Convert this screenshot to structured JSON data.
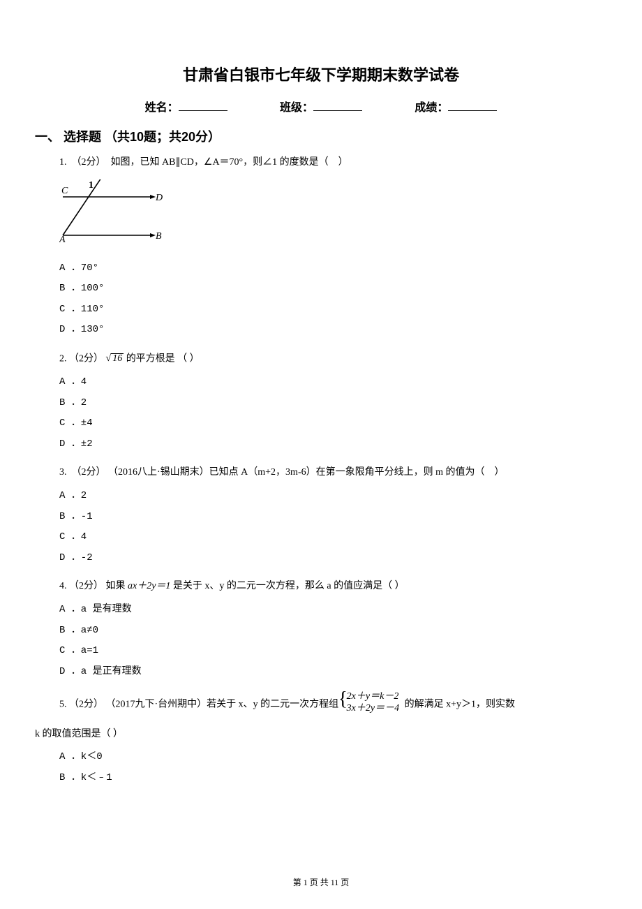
{
  "title": "甘肃省白银市七年级下学期期末数学试卷",
  "info": {
    "name_label": "姓名：",
    "class_label": "班级：",
    "score_label": "成绩："
  },
  "section1": {
    "header": "一、 选择题 （共10题；共20分）"
  },
  "q1": {
    "stem": "1.  （2分）  如图，已知 AB∥CD，∠A＝70°，则∠1 的度数是（    ）",
    "figure_labels": {
      "c": "C",
      "d": "D",
      "a": "A",
      "b": "B",
      "one": "1"
    },
    "opts": {
      "a": "A ．70°",
      "b": "B ．100°",
      "c": "C ．110°",
      "d": "D ．130°"
    }
  },
  "q2": {
    "prefix": "2.  （2分）",
    "sqrt_inner": "16",
    "suffix": "的平方根是    （    ）",
    "opts": {
      "a": "A ．4",
      "b": "B ．2",
      "c": "C ．±4",
      "d": "D ．±2"
    }
  },
  "q3": {
    "stem": "3.  （2分） （2016八上·锡山期末）已知点 A（m+2，3m-6）在第一象限角平分线上，则 m 的值为（    ）",
    "opts": {
      "a": "A ．2",
      "b": "B ．-1",
      "c": "C ．4",
      "d": "D ．-2"
    }
  },
  "q4": {
    "prefix": "4.  （2分）  如果 ",
    "equation": "ax＋2y＝1",
    "suffix": " 是关于 x、y 的二元一次方程，那么 a 的值应满足（    ）",
    "opts": {
      "a": "A ．a 是有理数",
      "b": "B ．a≠0",
      "c": "C ．a=1",
      "d": "D ．a 是正有理数"
    }
  },
  "q5": {
    "prefix": "5.  （2分） （2017九下·台州期中）若关于 x、y 的二元一次方程组 ",
    "eq_row1": "2x＋y＝k－2",
    "eq_row2": "3x＋2y＝－4",
    "suffix": " 的解满足 x+y＞1，则实数",
    "cont": "k 的取值范围是（    ）",
    "opts": {
      "a": "A ．k＜0",
      "b": "B ．k＜﹣1"
    }
  },
  "footer": "第 1 页 共 11 页"
}
